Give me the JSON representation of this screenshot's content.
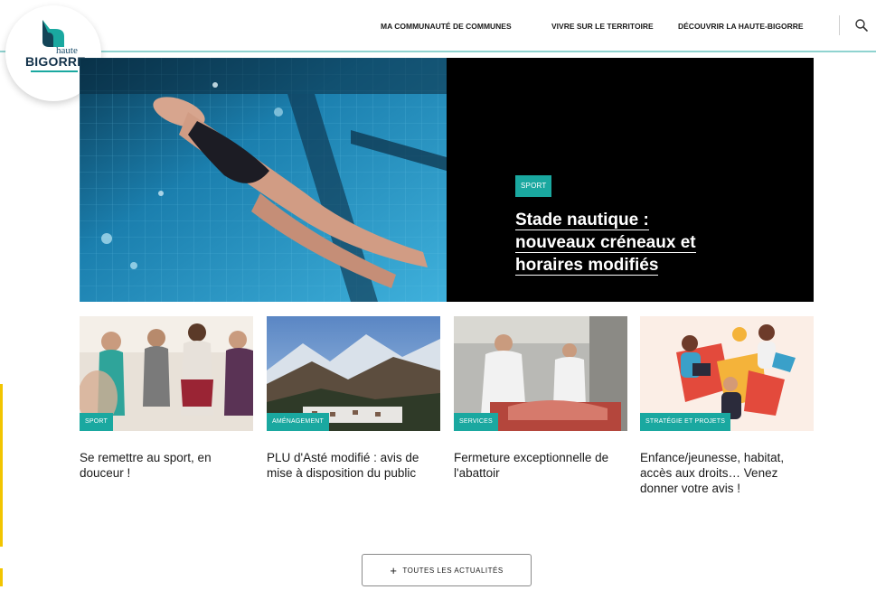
{
  "brand": {
    "logo_top": "haute",
    "logo_main": "BIGORRE"
  },
  "nav": {
    "items": [
      "MA COMMUNAUTÉ DE COMMUNES",
      "VIVRE SUR LE TERRITOIRE",
      "DÉCOUVRIR LA HAUTE-BIGORRE"
    ],
    "search_icon": "search-icon"
  },
  "hero": {
    "tag": "SPORT",
    "title_lines": [
      "Stade nautique :",
      "nouveaux créneaux et",
      "horaires modifiés"
    ]
  },
  "cards": [
    {
      "tag": "SPORT",
      "title": "Se remettre au sport, en douceur !"
    },
    {
      "tag": "AMÉNAGEMENT",
      "title": "PLU d'Asté modifié : avis de mise à disposition du public"
    },
    {
      "tag": "SERVICES",
      "title": "Fermeture exceptionnelle de l'abattoir"
    },
    {
      "tag": "STRATÉGIE ET PROJETS",
      "title": "Enfance/jeunesse, habitat, accès aux droits… Venez donner votre avis !"
    }
  ],
  "all_news_button": {
    "icon": "+",
    "label": "TOUTES LES ACTUALITÉS"
  },
  "colors": {
    "accent": "#1aa8a0",
    "yellow": "#f2c500",
    "hero_bg": "#000000"
  }
}
